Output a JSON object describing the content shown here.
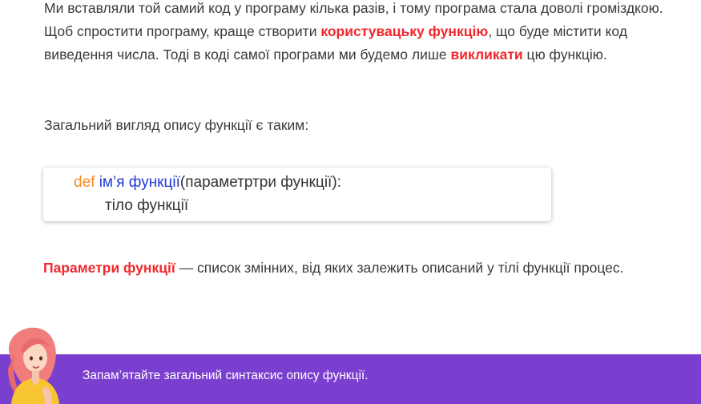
{
  "paragraph1": {
    "text_a": "Ми вставляли той самий код у програму кілька разів, і тому програма стала доволі громіздкою. Щоб спростити програму, краще створити ",
    "highlight_a": "користувацьку функцію",
    "text_b": ", що буде містити код виведення числа. Тоді в коді самої програми ми будемо лише ",
    "highlight_b": "викликати",
    "text_c": " цю функцію."
  },
  "paragraph2": "Загальний вигляд опису функції є таким:",
  "code": {
    "keyword": "def",
    "function_name": "ім’я функції",
    "params": "(параметртри функції):",
    "body": "тіло функції"
  },
  "paragraph3": {
    "highlight": "Параметри функції",
    "text": " — список змінних, від яких залежить описаний у тілі функції процес."
  },
  "banner": {
    "text": "Запам’ятайте загальний синтаксис опису функції."
  },
  "colors": {
    "highlight": "#f0282d",
    "keyword": "#f58a1f",
    "function_name": "#1f3bd6",
    "banner_bg": "#7b3fcf"
  }
}
